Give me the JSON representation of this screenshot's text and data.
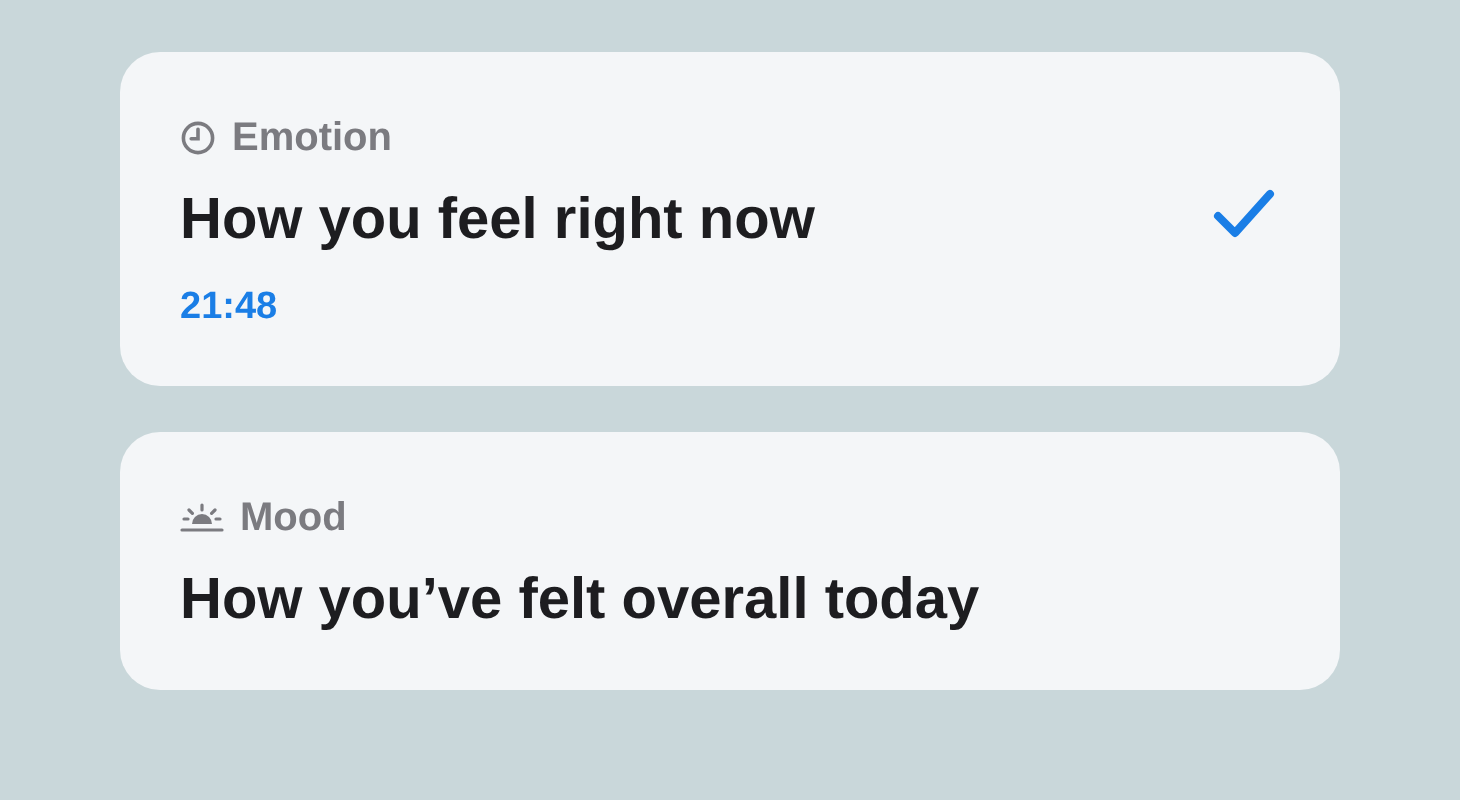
{
  "cards": [
    {
      "kind": "clock",
      "category": "Emotion",
      "title": "How you feel right now",
      "time": "21:48",
      "selected": true
    },
    {
      "kind": "sunrise",
      "category": "Mood",
      "title": "How you’ve felt overall today",
      "selected": false
    }
  ]
}
